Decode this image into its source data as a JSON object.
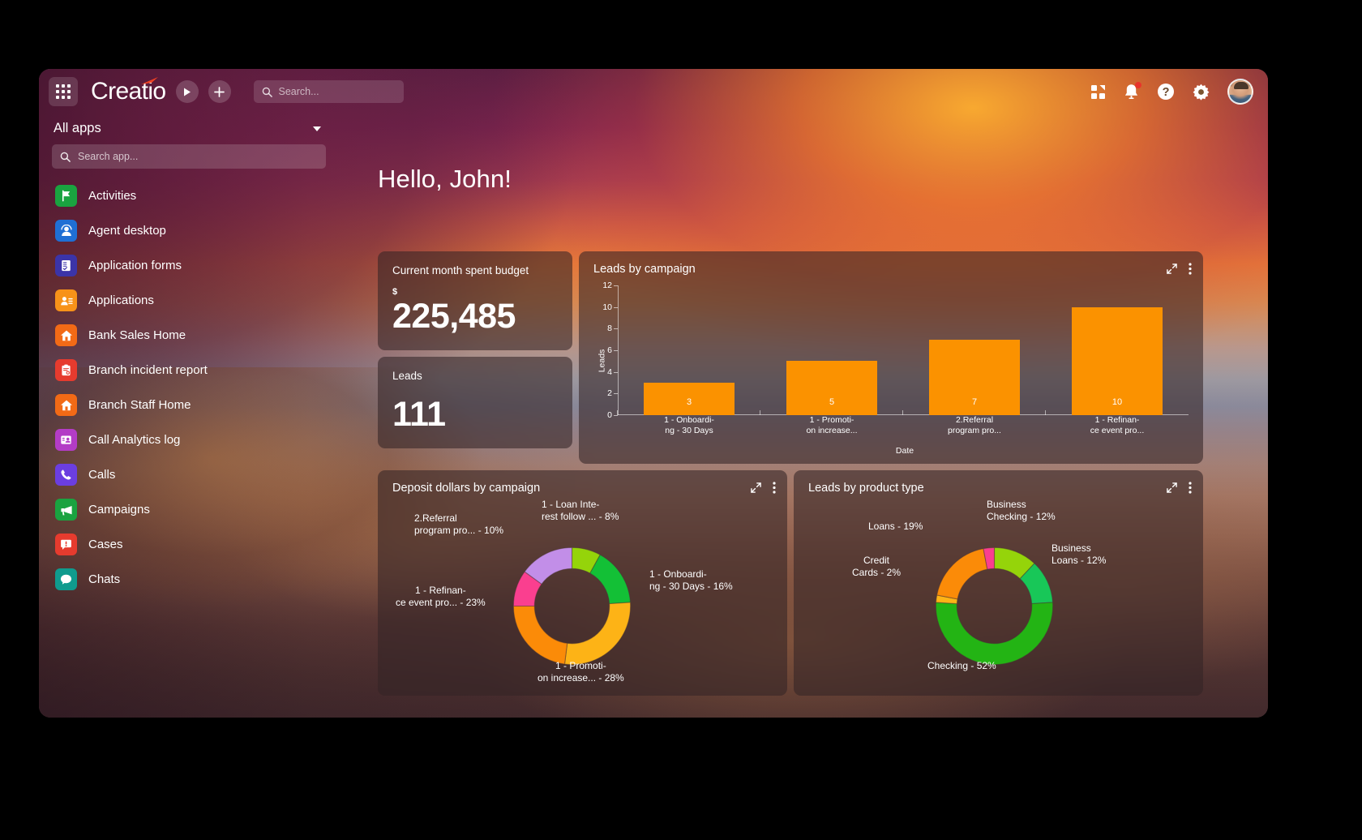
{
  "topbar": {
    "grid_icon": "apps-grid-icon",
    "brand": "Creatio",
    "play_icon": "play-icon",
    "add_icon": "plus-icon",
    "search": {
      "icon": "search-icon",
      "placeholder": "Search...",
      "value": ""
    },
    "right_icons": [
      {
        "name": "apps-marketplace-icon",
        "label": "Apps"
      },
      {
        "name": "notifications-bell-icon",
        "label": "Notifications",
        "badge": true
      },
      {
        "name": "help-icon",
        "label": "Help"
      },
      {
        "name": "settings-gear-icon",
        "label": "Settings"
      },
      {
        "name": "user-avatar",
        "label": "Profile"
      }
    ]
  },
  "sidebar": {
    "all_apps_label": "All apps",
    "search": {
      "icon": "search-icon",
      "placeholder": "Search app...",
      "value": ""
    },
    "items": [
      {
        "label": "Activities",
        "icon": "flag-icon",
        "color": "#1aa340"
      },
      {
        "label": "Agent desktop",
        "icon": "headset-icon",
        "color": "#1f6fd4"
      },
      {
        "label": "Application forms",
        "icon": "form-icon",
        "color": "#3b34a8"
      },
      {
        "label": "Applications",
        "icon": "contact-icon",
        "color": "#f79219"
      },
      {
        "label": "Bank Sales Home",
        "icon": "home-icon",
        "color": "#f26a16"
      },
      {
        "label": "Branch incident report",
        "icon": "report-icon",
        "color": "#e63b2e"
      },
      {
        "label": "Branch Staff Home",
        "icon": "home-icon",
        "color": "#f26a16"
      },
      {
        "label": "Call Analytics log",
        "icon": "call-card-icon",
        "color": "#b33cc6"
      },
      {
        "label": "Calls",
        "icon": "phone-icon",
        "color": "#6b3ee0"
      },
      {
        "label": "Campaigns",
        "icon": "megaphone-icon",
        "color": "#1aa340"
      },
      {
        "label": "Cases",
        "icon": "case-alert-icon",
        "color": "#e63b2e"
      },
      {
        "label": "Chats",
        "icon": "chat-icon",
        "color": "#0f9b8e"
      }
    ]
  },
  "main": {
    "greeting": "Hello, John!",
    "kpis": [
      {
        "title": "Current month spent budget",
        "currency": "$",
        "value": "225,485"
      },
      {
        "title": "Leads",
        "currency": "",
        "value": "111"
      }
    ],
    "cards": {
      "bar": {
        "title": "Leads by campaign",
        "expand_icon": "expand-icon",
        "menu_icon": "kebab-menu-icon"
      },
      "donut1": {
        "title": "Deposit dollars by campaign",
        "expand_icon": "expand-icon",
        "menu_icon": "kebab-menu-icon"
      },
      "donut2": {
        "title": "Leads by product type",
        "expand_icon": "expand-icon",
        "menu_icon": "kebab-menu-icon"
      }
    }
  },
  "chart_data": [
    {
      "type": "bar",
      "title": "Leads by campaign",
      "xlabel": "Date",
      "ylabel": "Leads",
      "ylim": [
        0,
        12
      ],
      "yticks": [
        0,
        2,
        4,
        6,
        8,
        10,
        12
      ],
      "grid": false,
      "legend": "none",
      "bar_color": "#fb9200",
      "categories": [
        "1 - Onboardi-\nng - 30 Days",
        "1 - Promoti-\non increase...",
        "2.Referral\nprogram pro...",
        "1 - Refinan-\nce event pro..."
      ],
      "category_lines": [
        [
          "1 - Onboardi-",
          "ng - 30 Days"
        ],
        [
          "1 - Promoti-",
          "on increase..."
        ],
        [
          "2.Referral",
          "program pro..."
        ],
        [
          "1 - Refinan-",
          "ce event pro..."
        ]
      ],
      "values": [
        3,
        5,
        7,
        10
      ]
    },
    {
      "type": "pie",
      "subtype": "donut",
      "title": "Deposit dollars by campaign",
      "legend": "labels-around-chart",
      "slices": [
        {
          "label_lines": [
            "1 - Loan Inte-",
            "rest follow ... - 8%"
          ],
          "value": 8,
          "color": "#95d40a",
          "label_pos": "top-right"
        },
        {
          "label_lines": [
            "1 - Onboardi-",
            "ng - 30 Days - 16%"
          ],
          "value": 16,
          "color": "#13c036",
          "label_pos": "right"
        },
        {
          "label_lines": [
            "1 - Promoti-",
            "on increase... - 28%"
          ],
          "value": 28,
          "color": "#fdb316",
          "label_pos": "bottom"
        },
        {
          "label_lines": [
            "1 - Refinan-",
            "ce event pro... - 23%"
          ],
          "value": 23,
          "color": "#fb8b08",
          "label_pos": "left"
        },
        {
          "label_lines": [
            "2.Referral",
            "program pro... - 10%"
          ],
          "value": 10,
          "color": "#fa3f8f",
          "label_pos": "top-left"
        },
        {
          "label_lines": [],
          "value": 15,
          "color": "#c28ee8",
          "label_pos": "none"
        }
      ]
    },
    {
      "type": "pie",
      "subtype": "donut",
      "title": "Leads by product type",
      "legend": "labels-around-chart",
      "slices": [
        {
          "label_lines": [
            "Business",
            "Checking - 12%"
          ],
          "value": 12,
          "color": "#95d40a",
          "label_pos": "top-right"
        },
        {
          "label_lines": [
            "Business",
            "Loans - 12%"
          ],
          "value": 12,
          "color": "#18c758",
          "label_pos": "right"
        },
        {
          "label_lines": [
            "Checking - 52%"
          ],
          "value": 52,
          "color": "#23b414",
          "label_pos": "bottom"
        },
        {
          "label_lines": [
            "Credit",
            "Cards - 2%"
          ],
          "value": 2,
          "color": "#fdb316",
          "label_pos": "left"
        },
        {
          "label_lines": [
            "Loans - 19%"
          ],
          "value": 19,
          "color": "#fb8b08",
          "label_pos": "top-left"
        },
        {
          "label_lines": [],
          "value": 3,
          "color": "#fa3f8f",
          "label_pos": "none"
        }
      ]
    }
  ]
}
